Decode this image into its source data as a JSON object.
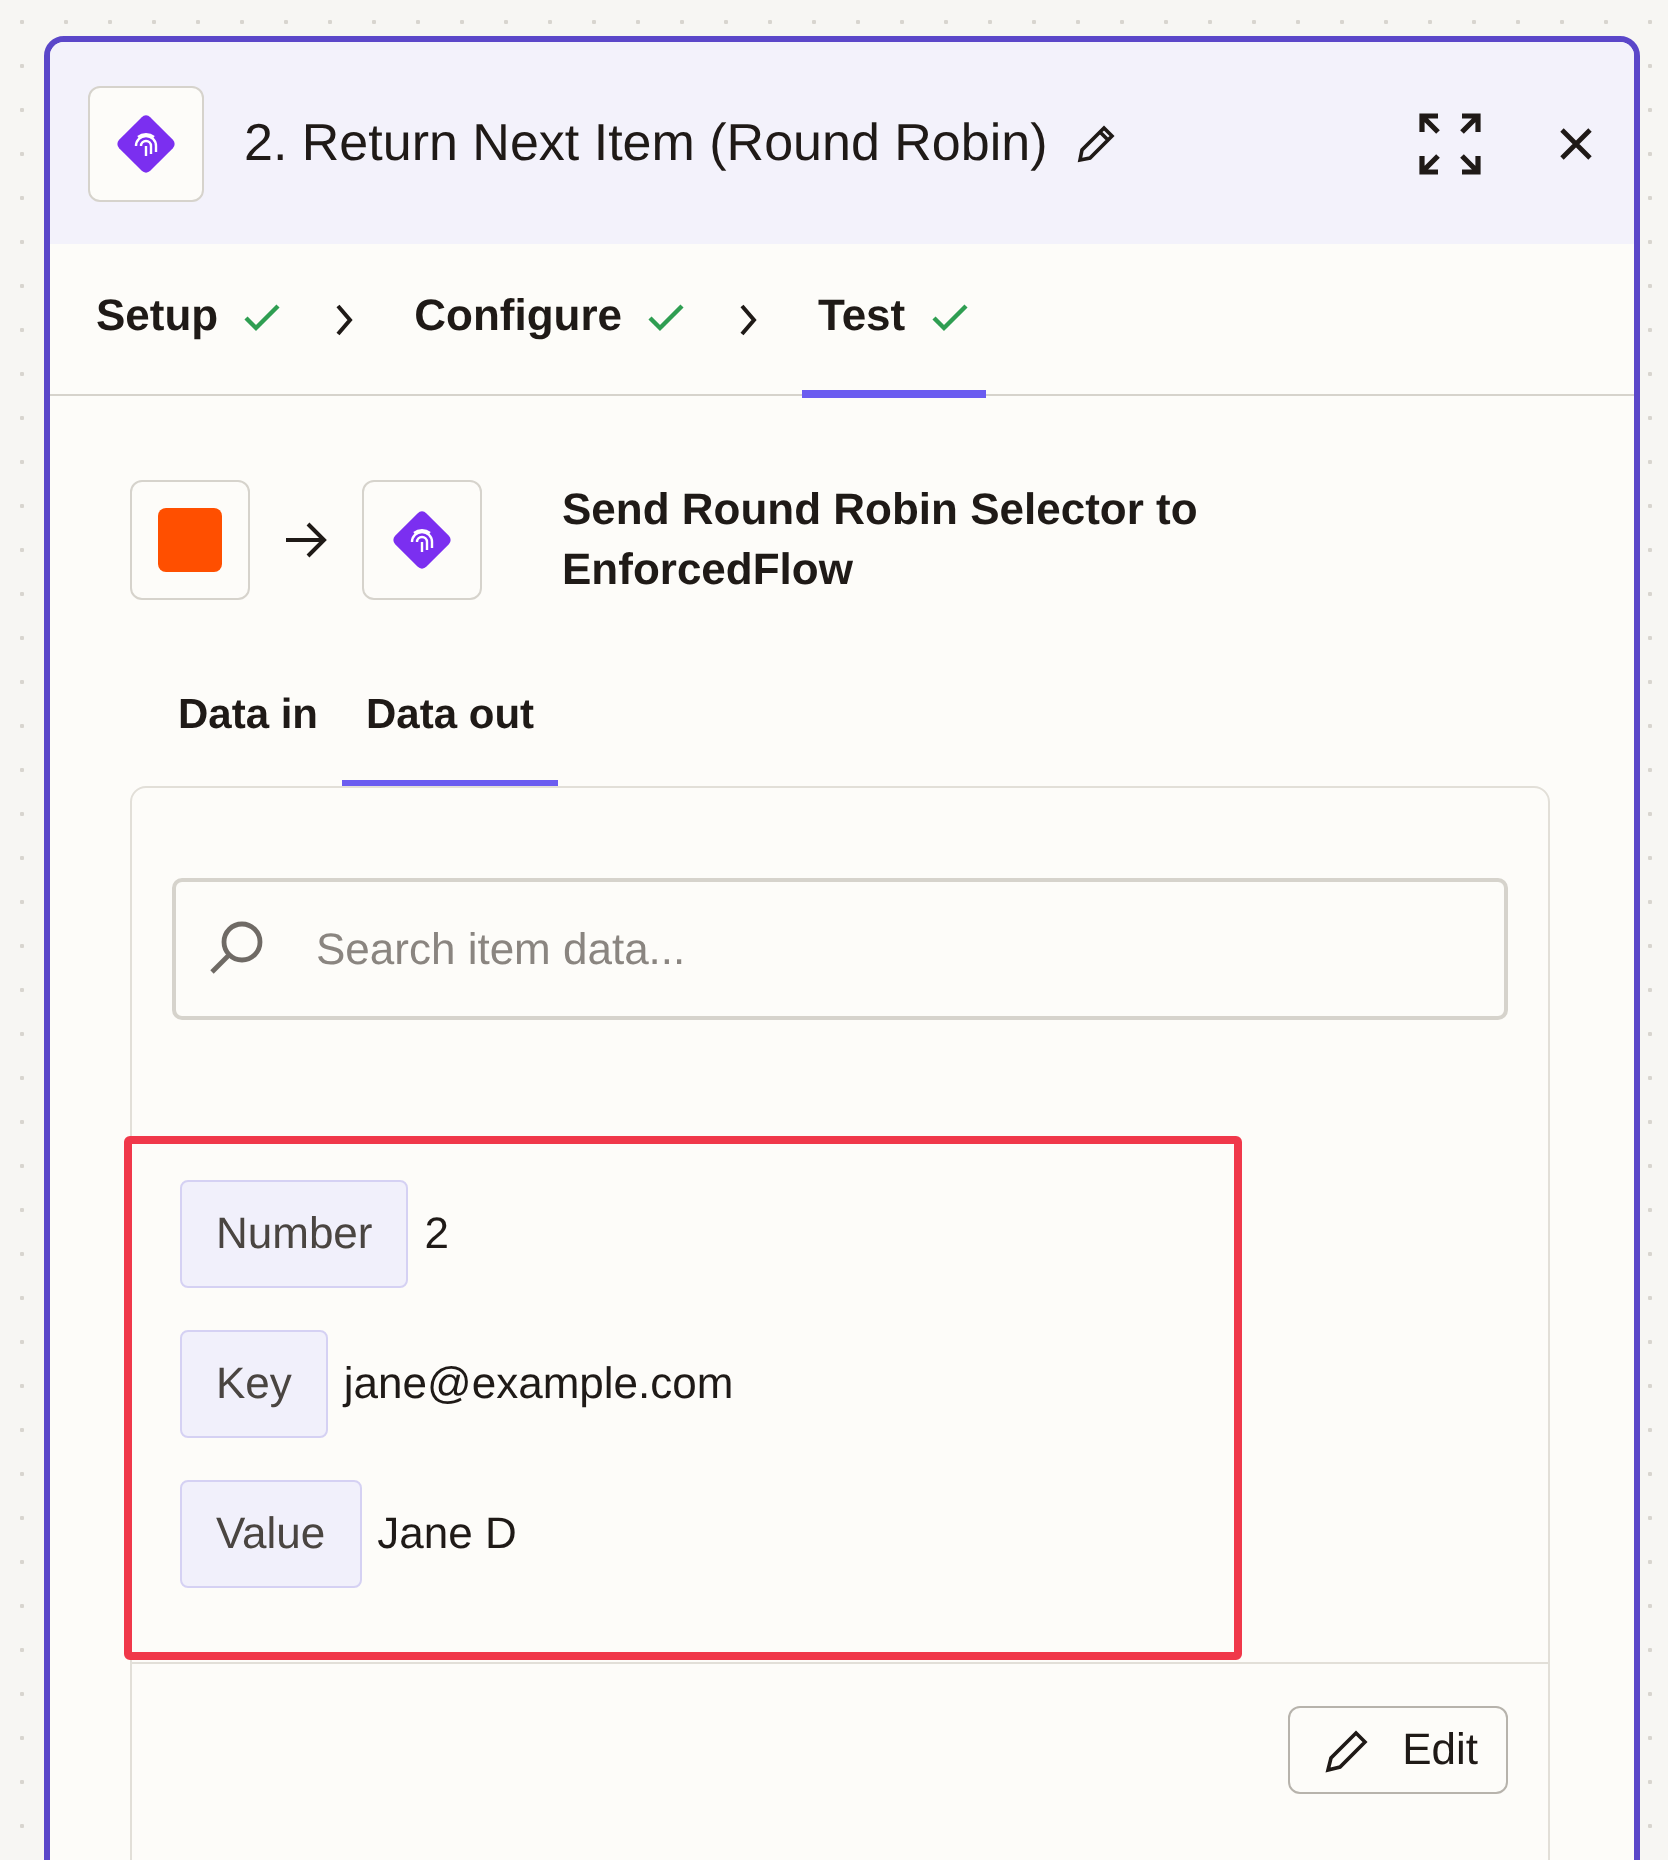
{
  "panel": {
    "title": "2. Return Next Item (Round Robin)"
  },
  "steps": [
    {
      "label": "Setup",
      "completed": true,
      "selected": false
    },
    {
      "label": "Configure",
      "completed": true,
      "selected": false
    },
    {
      "label": "Test",
      "completed": true,
      "selected": true
    }
  ],
  "action": {
    "title": "Send Round Robin Selector to EnforcedFlow"
  },
  "data_tabs": [
    {
      "label": "Data in",
      "selected": false
    },
    {
      "label": "Data out",
      "selected": true
    }
  ],
  "search": {
    "placeholder": "Search item data..."
  },
  "fields": [
    {
      "key": "Number",
      "value": "2"
    },
    {
      "key": "Key",
      "value": "jane@example.com"
    },
    {
      "key": "Value",
      "value": "Jane D"
    }
  ],
  "edit_button": "Edit"
}
